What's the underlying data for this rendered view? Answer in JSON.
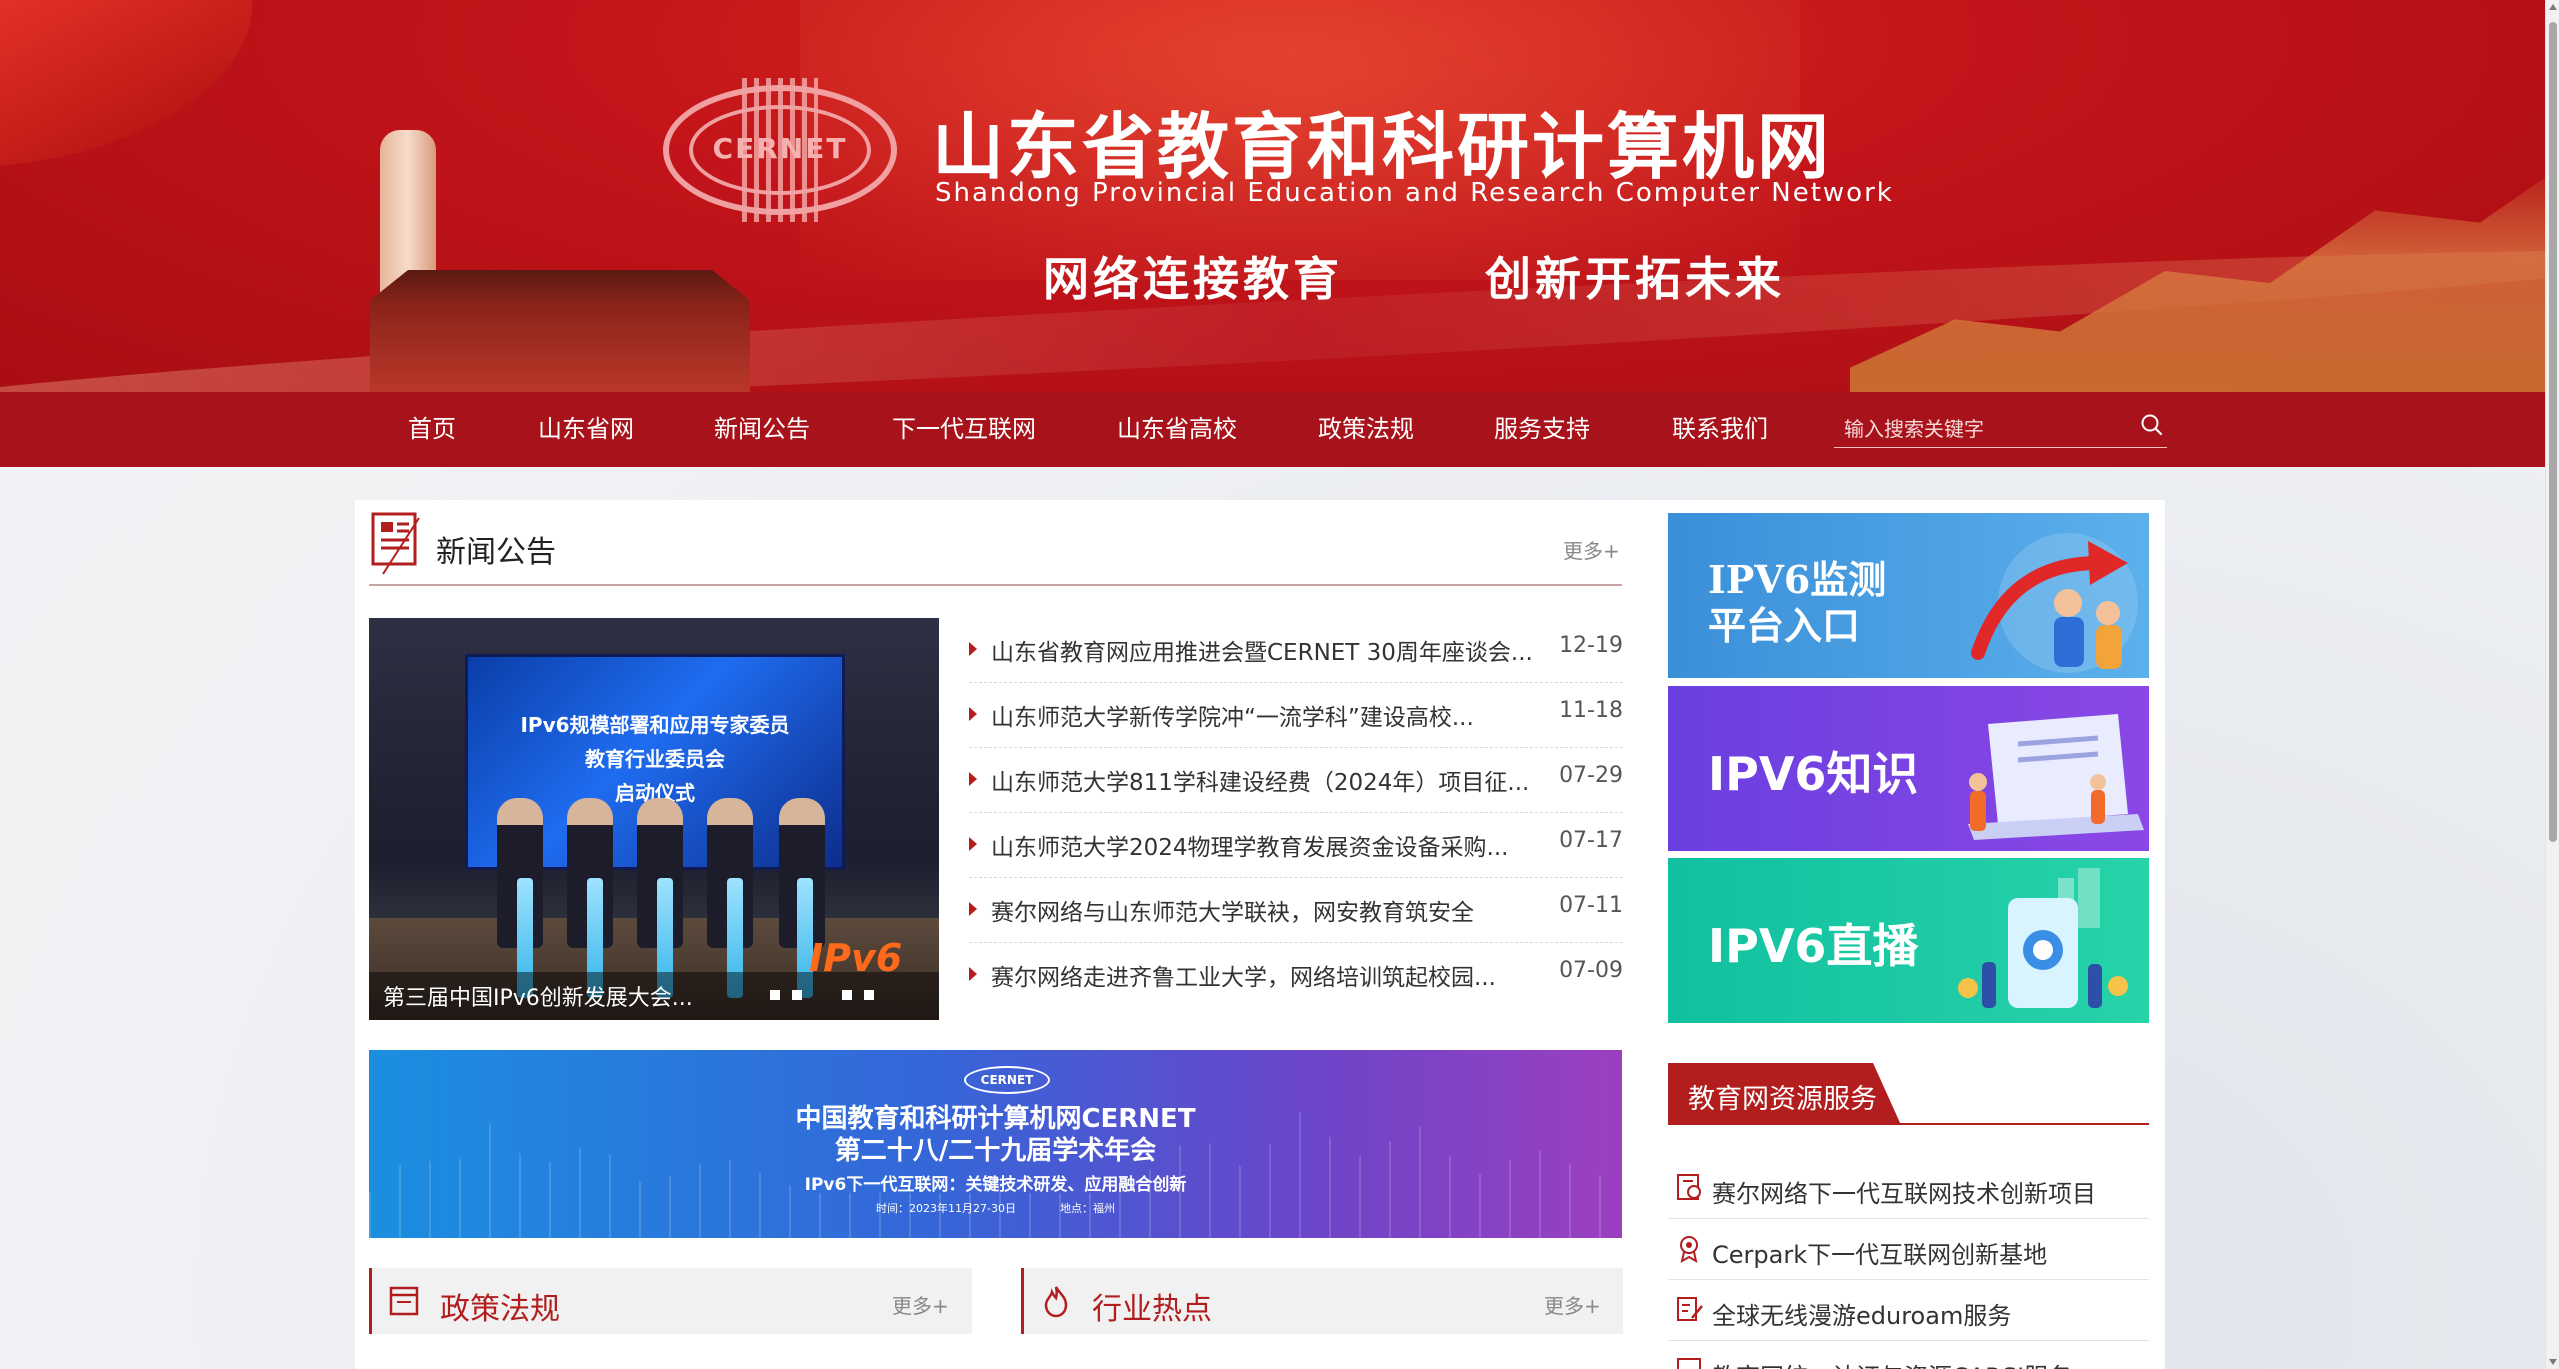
{
  "header": {
    "logo_text": "CERNET",
    "title": "山东省教育和科研计算机网",
    "subtitle": "Shandong Provincial Education and Research Computer Network",
    "slogan_1": "网络连接教育",
    "slogan_2": "创新开拓未来"
  },
  "nav": {
    "items": [
      "首页",
      "山东省网",
      "新闻公告",
      "下一代互联网",
      "山东省高校",
      "政策法规",
      "服务支持",
      "联系我们"
    ],
    "search_placeholder": "输入搜索关键字",
    "search_icon": "search-icon"
  },
  "news": {
    "section_title": "新闻公告",
    "more_label": "更多+",
    "slider": {
      "screen_lines": [
        "IPv6规模部署和应用专家委员",
        "教育行业委员会",
        "启动仪式"
      ],
      "badge": "IPv6",
      "caption": "第三届中国IPv6创新发展大会..."
    },
    "items": [
      {
        "title": "山东省教育网应用推进会暨CERNET 30周年座谈会...",
        "date": "12-19"
      },
      {
        "title": "山东师范大学新传学院冲“一流学科”建设高校...",
        "date": "11-18"
      },
      {
        "title": "山东师范大学811学科建设经费（2024年）项目征...",
        "date": "07-29"
      },
      {
        "title": "山东师范大学2024物理学教育发展资金设备采购...",
        "date": "07-17"
      },
      {
        "title": "赛尔网络与山东师范大学联袂，网安教育筑安全",
        "date": "07-11"
      },
      {
        "title": "赛尔网络走进齐鲁工业大学，网络培训筑起校园...",
        "date": "07-09"
      }
    ]
  },
  "conference_banner": {
    "logo": "CERNET",
    "line1": "中国教育和科研计算机网CERNET",
    "line2": "第二十八/二十九届学术年会",
    "line3": "IPv6下一代互联网：关键技术研发、应用融合创新",
    "line4": "时间：2023年11月27-30日　　　　地点：福州"
  },
  "policy": {
    "title": "政策法规",
    "more_label": "更多+"
  },
  "industry": {
    "title": "行业热点",
    "more_label": "更多+"
  },
  "sidebar": {
    "cards": [
      {
        "label_1": "IPV6监测",
        "label_2": "平台入口"
      },
      {
        "label_1": "IPV6知识"
      },
      {
        "label_1": "IPV6直播"
      }
    ],
    "resource_title": "教育网资源服务",
    "resources": [
      "赛尔网络下一代互联网技术创新项目",
      "Cerpark下一代互联网创新基地",
      "全球无线漫游eduroam服务",
      "教育网统一认证与资源CARSI服务"
    ]
  },
  "colors": {
    "brand_red": "#a8121a",
    "accent_red": "#b21e1e"
  }
}
